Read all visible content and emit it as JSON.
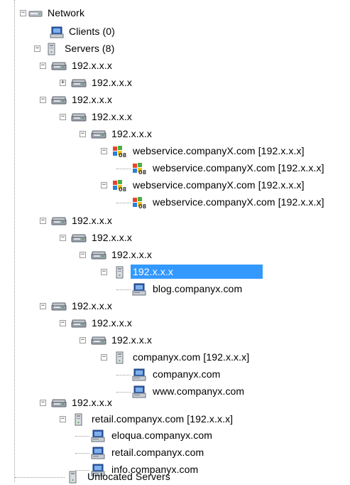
{
  "tree": {
    "network": {
      "label": "Network"
    },
    "clients": {
      "label": "Clients (0)"
    },
    "servers": {
      "label": "Servers (8)"
    },
    "unlocated": {
      "label": "Unlocated Servers"
    },
    "items": [
      {
        "label": "192.x.x.x",
        "icon": "router-icon",
        "expander": "minus",
        "depth": 3
      },
      {
        "label": "192.x.x.x",
        "icon": "router-icon",
        "expander": "plus",
        "depth": 4
      },
      {
        "label": "192.x.x.x",
        "icon": "router-icon",
        "expander": "minus",
        "depth": 3
      },
      {
        "label": "192.x.x.x",
        "icon": "router-icon",
        "expander": "minus",
        "depth": 4
      },
      {
        "label": "192.x.x.x",
        "icon": "router-icon",
        "expander": "minus",
        "depth": 5
      },
      {
        "label": "webservice.companyX.com [192.x.x.x]",
        "icon": "windows-server-2008-icon",
        "expander": "minus",
        "depth": 6
      },
      {
        "label": "webservice.companyX.com [192.x.x.x]",
        "icon": "windows-server-2008-icon",
        "expander": "none",
        "depth": 7
      },
      {
        "label": "webservice.companyX.com [192.x.x.x]",
        "icon": "windows-server-2008-icon",
        "expander": "minus",
        "depth": 6
      },
      {
        "label": "webservice.companyX.com [192.x.x.x]",
        "icon": "windows-server-2008-icon",
        "expander": "none",
        "depth": 7
      },
      {
        "label": "192.x.x.x",
        "icon": "router-icon",
        "expander": "minus",
        "depth": 3
      },
      {
        "label": "192.x.x.x",
        "icon": "router-icon",
        "expander": "minus",
        "depth": 4
      },
      {
        "label": "192.x.x.x",
        "icon": "router-icon",
        "expander": "minus",
        "depth": 5
      },
      {
        "label": "192.x.x.x",
        "icon": "server-tower-icon",
        "expander": "minus",
        "depth": 6,
        "selected": true
      },
      {
        "label": "blog.companyx.com",
        "icon": "computer-icon",
        "expander": "none",
        "depth": 7
      },
      {
        "label": "192.x.x.x",
        "icon": "router-icon",
        "expander": "minus",
        "depth": 3
      },
      {
        "label": "192.x.x.x",
        "icon": "router-icon",
        "expander": "minus",
        "depth": 4
      },
      {
        "label": "192.x.x.x",
        "icon": "router-icon",
        "expander": "minus",
        "depth": 5
      },
      {
        "label": "companyx.com [192.x.x.x]",
        "icon": "server-tower-icon",
        "expander": "minus",
        "depth": 6
      },
      {
        "label": "companyx.com",
        "icon": "computer-icon",
        "expander": "none",
        "depth": 7
      },
      {
        "label": "www.companyx.com",
        "icon": "computer-icon",
        "expander": "none",
        "depth": 7
      },
      {
        "label": "192.x.x.x",
        "icon": "router-icon",
        "expander": "minus",
        "depth": 3
      },
      {
        "label": "retail.companyx.com [192.x.x.x]",
        "icon": "server-tower-icon",
        "expander": "minus",
        "depth": 4
      },
      {
        "label": "eloqua.companyx.com",
        "icon": "computer-icon",
        "expander": "none",
        "depth": 5
      },
      {
        "label": "retail.companyx.com",
        "icon": "computer-icon",
        "expander": "none",
        "depth": 5
      },
      {
        "label": "info.companyx.com",
        "icon": "computer-icon",
        "expander": "none",
        "depth": 5
      }
    ]
  },
  "colors": {
    "selection": "#3399ff",
    "selected_text": "#ffffff",
    "connector": "#9a9a9a"
  }
}
